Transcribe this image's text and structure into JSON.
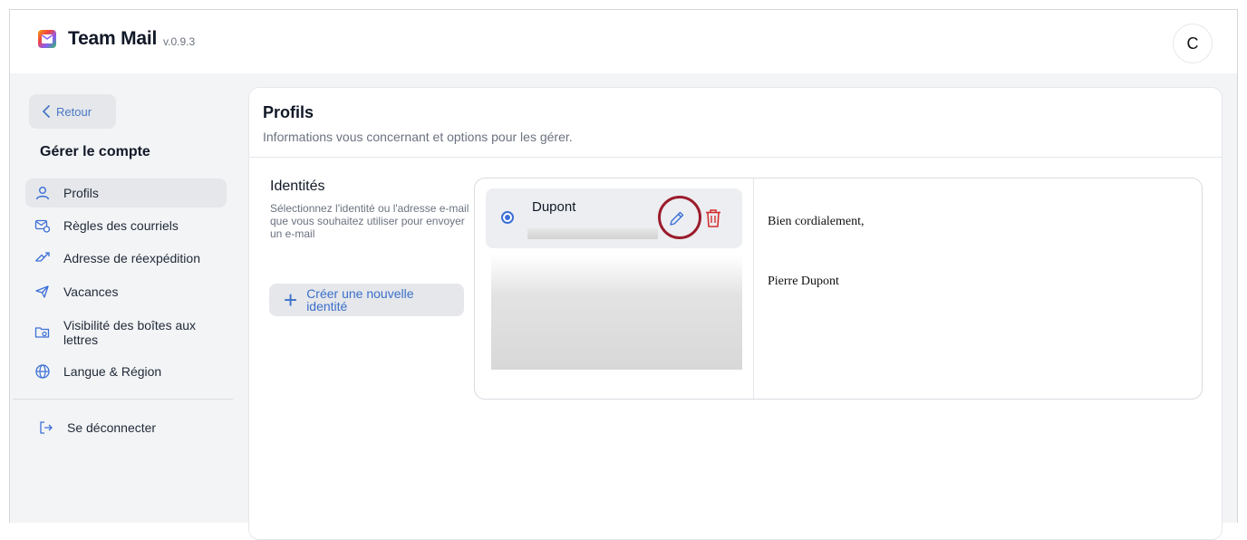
{
  "app": {
    "title": "Team Mail",
    "version": "v.0.9.3",
    "avatar_initial": "C"
  },
  "sidebar": {
    "back_label": "Retour",
    "title": "Gérer le compte",
    "items": [
      {
        "label": "Profils",
        "icon": "user-icon",
        "active": true
      },
      {
        "label": "Règles des courriels",
        "icon": "mail-rules-icon"
      },
      {
        "label": "Adresse de réexpédition",
        "icon": "forward-icon"
      },
      {
        "label": "Vacances",
        "icon": "airplane-icon"
      },
      {
        "label": "Visibilité des boîtes aux lettres",
        "icon": "folder-eye-icon"
      },
      {
        "label": "Langue & Région",
        "icon": "globe-icon"
      }
    ],
    "logout_label": "Se déconnecter"
  },
  "main": {
    "title": "Profils",
    "subtitle": "Informations vous concernant et options pour les gérer.",
    "identities": {
      "title": "Identités",
      "description": "Sélectionnez l'identité ou l'adresse e-mail que vous souhaitez utiliser pour envoyer un e-mail",
      "create_label": "Créer une nouvelle identité",
      "list": [
        {
          "name": "Dupont",
          "selected": true
        }
      ],
      "signature": {
        "line1": "Bien cordialement,",
        "line2": "Pierre Dupont"
      }
    }
  },
  "colors": {
    "accent": "#3b6fd6",
    "delete": "#d32f2f",
    "highlight": "#9b1c2c"
  }
}
